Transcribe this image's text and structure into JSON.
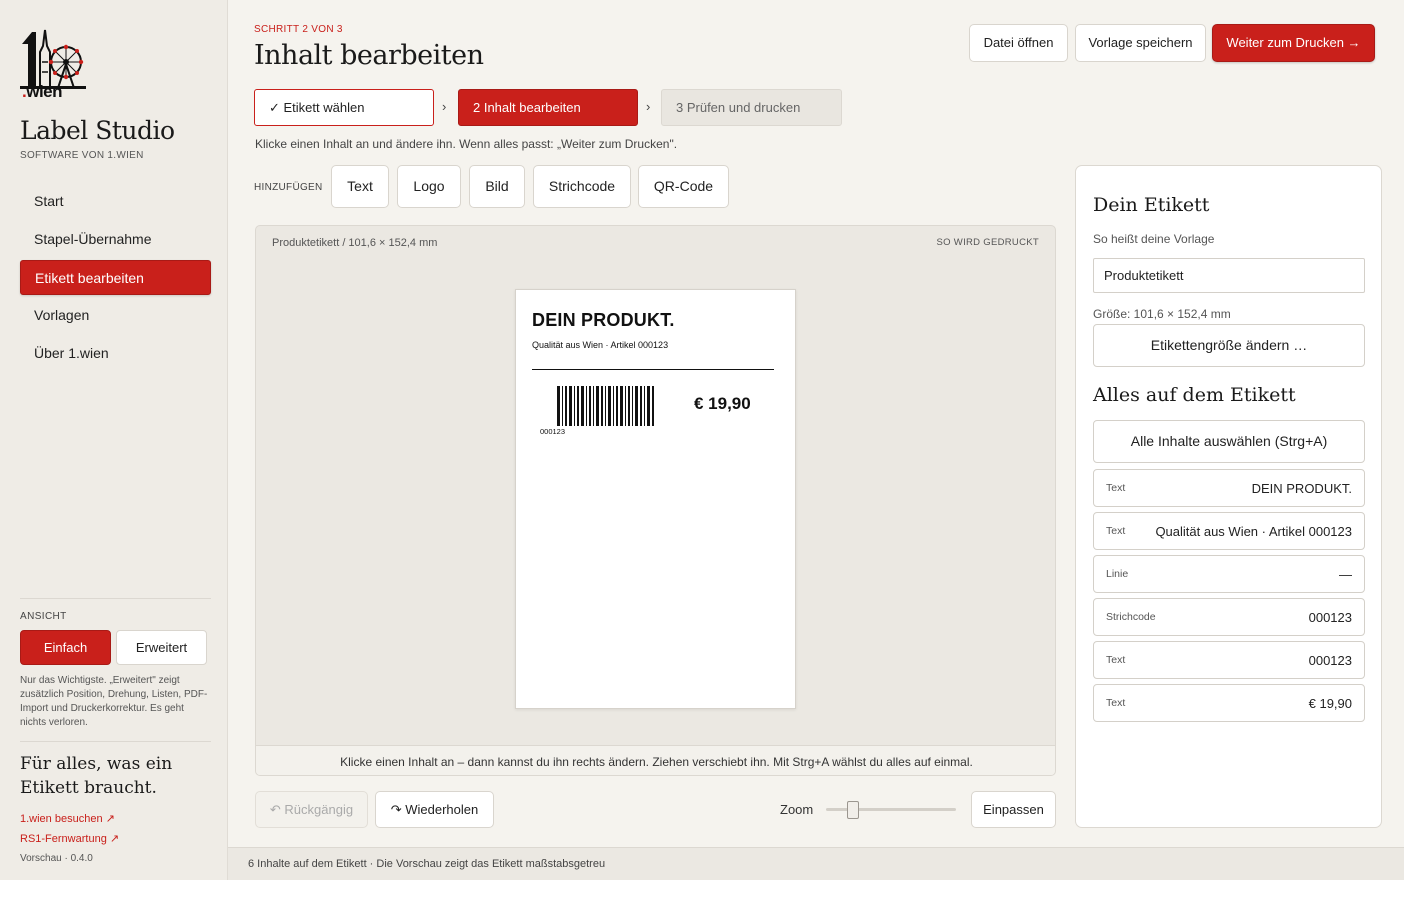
{
  "brand": {
    "logo_text_dot": ".",
    "logo_text_word": "wien",
    "app_title": "Label Studio",
    "app_subtitle": "SOFTWARE VON 1.WIEN"
  },
  "nav": [
    {
      "label": "Start",
      "active": false
    },
    {
      "label": "Stapel-Übernahme",
      "active": false
    },
    {
      "label": "Etikett bearbeiten",
      "active": true
    },
    {
      "label": "Vorlagen",
      "active": false
    },
    {
      "label": "Über 1.wien",
      "active": false
    }
  ],
  "view": {
    "label": "ANSICHT",
    "simple": "Einfach",
    "advanced": "Erweitert",
    "help": "Nur das Wichtigste. „Erweitert\" zeigt zusätzlich Position, Drehung, Listen, PDF-Import und Druckerkorrektur. Es geht nichts verloren."
  },
  "slogan": "Für alles, was ein Etikett braucht.",
  "links": {
    "visit": "1.wien besuchen ↗",
    "remote": "RS1-Fernwartung ↗"
  },
  "version": "Vorschau · 0.4.0",
  "header": {
    "kicker": "SCHRITT 2 VON 3",
    "title": "Inhalt bearbeiten",
    "open_file": "Datei öffnen",
    "save_template": "Vorlage speichern",
    "continue": "Weiter zum Drucken →"
  },
  "steps": [
    {
      "label": "✓  Etikett wählen"
    },
    {
      "label": "2  Inhalt bearbeiten"
    },
    {
      "label": "3  Prüfen und drucken"
    }
  ],
  "step_separator": "›",
  "instruction": "Klicke einen Inhalt an und ändere ihn. Wenn alles passt: „Weiter zum Drucken\".",
  "add": {
    "label": "HINZUFÜGEN",
    "buttons": [
      "Text",
      "Logo",
      "Bild",
      "Strichcode",
      "QR-Code"
    ]
  },
  "canvas": {
    "path": "Produktetikett  /  101,6 × 152,4 mm",
    "print_note": "SO WIRD GEDRUCKT",
    "hint": "Klicke einen Inhalt an – dann kannst du ihn rechts ändern. Ziehen verschiebt ihn. Mit Strg+A wählst du alles auf einmal."
  },
  "label_preview": {
    "title": "DEIN PRODUKT.",
    "subtitle": "Qualität aus Wien · Artikel 000123",
    "barcode_number": "000123",
    "price": "€ 19,90"
  },
  "toolbar": {
    "undo": "↶  Rückgängig",
    "redo": "↷  Wiederholen",
    "zoom_label": "Zoom",
    "zoom_value": 0.18,
    "fit": "Einpassen"
  },
  "panel": {
    "heading": "Dein Etikett",
    "name_label": "So heißt deine Vorlage",
    "name_value": "Produktetikett",
    "size_text": "Größe: 101,6 × 152,4 mm",
    "change_size": "Etikettengröße ändern …",
    "contents_heading": "Alles auf dem Etikett",
    "select_all": "Alle Inhalte auswählen (Strg+A)",
    "items": [
      {
        "type": "Text",
        "value": "DEIN PRODUKT."
      },
      {
        "type": "Text",
        "value": "Qualität aus Wien · Artikel 000123"
      },
      {
        "type": "Linie",
        "value": "—"
      },
      {
        "type": "Strichcode",
        "value": "000123"
      },
      {
        "type": "Text",
        "value": "000123"
      },
      {
        "type": "Text",
        "value": "€ 19,90"
      }
    ]
  },
  "status": "6 Inhalte auf dem Etikett · Die Vorschau zeigt das Etikett maßstabsgetreu",
  "colors": {
    "accent": "#c9201b",
    "background": "#f5f3ee",
    "sidebar": "#efece6"
  }
}
